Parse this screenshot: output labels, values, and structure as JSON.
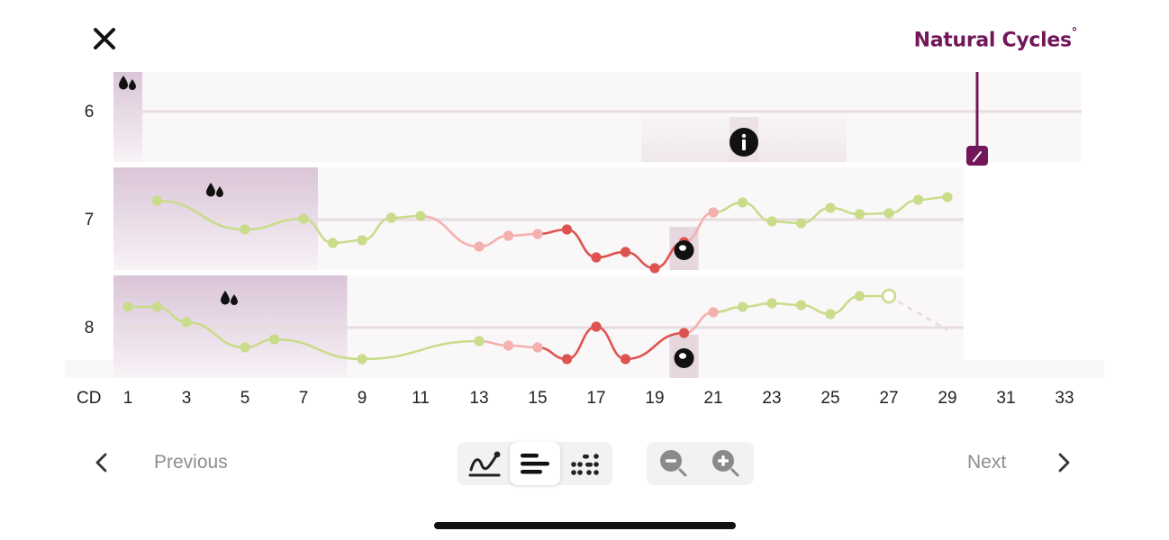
{
  "header": {
    "close_icon": "close-icon",
    "brand_name": "Natural Cycles",
    "brand_mark": "°",
    "brand_color": "#72185a"
  },
  "chart": {
    "row_labels": [
      "6",
      "7",
      "8"
    ],
    "period_icon": "blood-drops-icon",
    "info_icon": "info-icon",
    "ovulation_icon": "ovulation-icon",
    "today_icon": "thermometer-icon",
    "colors": {
      "green_day": "#c9dc8a",
      "red_day": "#de5350",
      "pink_day": "#f3b0ae",
      "period_band": "#dac5d8",
      "today_marker": "#72185a"
    }
  },
  "x_axis": {
    "label": "CD",
    "ticks": [
      "1",
      "3",
      "5",
      "7",
      "9",
      "11",
      "13",
      "15",
      "17",
      "19",
      "21",
      "23",
      "25",
      "27",
      "29",
      "31",
      "33"
    ]
  },
  "bottom_nav": {
    "previous_label": "Previous",
    "next_label": "Next",
    "view_modes": [
      "graph-view-icon",
      "cycle-list-view-icon",
      "dot-view-icon"
    ],
    "active_view": "cycle-list-view-icon",
    "zoom_out_icon": "zoom-out-icon",
    "zoom_in_icon": "zoom-in-icon"
  },
  "chart_data": {
    "type": "line",
    "xlabel": "CD",
    "xlim": [
      1,
      33
    ],
    "series": [
      {
        "name": "6",
        "points": [],
        "period_days": [
          1
        ],
        "today_cd": 30
      },
      {
        "name": "7",
        "points": [
          [
            2,
            0.75,
            "g"
          ],
          [
            5,
            0.43,
            "g"
          ],
          [
            7,
            0.55,
            "g"
          ],
          [
            8,
            0.28,
            "g"
          ],
          [
            9,
            0.31,
            "g"
          ],
          [
            10,
            0.56,
            "g"
          ],
          [
            11,
            0.58,
            "g"
          ],
          [
            13,
            0.24,
            "p"
          ],
          [
            14,
            0.36,
            "p"
          ],
          [
            15,
            0.38,
            "p"
          ],
          [
            16,
            0.43,
            "r"
          ],
          [
            17,
            0.12,
            "r"
          ],
          [
            18,
            0.18,
            "r"
          ],
          [
            19,
            0.0,
            "r"
          ],
          [
            20,
            0.29,
            "r"
          ],
          [
            21,
            0.62,
            "p"
          ],
          [
            22,
            0.73,
            "g"
          ],
          [
            23,
            0.52,
            "g"
          ],
          [
            24,
            0.5,
            "g"
          ],
          [
            25,
            0.67,
            "g"
          ],
          [
            26,
            0.6,
            "g"
          ],
          [
            27,
            0.61,
            "g"
          ],
          [
            28,
            0.76,
            "g"
          ],
          [
            29,
            0.79,
            "g"
          ]
        ],
        "period_days": [
          1,
          2,
          3,
          4,
          5,
          6,
          7
        ],
        "ovulation_cd": 20
      },
      {
        "name": "8",
        "points": [
          [
            1,
            0.58,
            "g"
          ],
          [
            2,
            0.58,
            "g"
          ],
          [
            3,
            0.41,
            "g"
          ],
          [
            5,
            0.13,
            "g"
          ],
          [
            6,
            0.22,
            "g"
          ],
          [
            9,
            0.0,
            "g"
          ],
          [
            13,
            0.2,
            "g"
          ],
          [
            14,
            0.15,
            "p"
          ],
          [
            15,
            0.13,
            "p"
          ],
          [
            16,
            0.0,
            "r"
          ],
          [
            17,
            0.36,
            "r"
          ],
          [
            18,
            0.0,
            "r"
          ],
          [
            20,
            0.29,
            "r"
          ],
          [
            21,
            0.52,
            "p"
          ],
          [
            22,
            0.58,
            "g"
          ],
          [
            23,
            0.62,
            "g"
          ],
          [
            24,
            0.6,
            "g"
          ],
          [
            25,
            0.5,
            "g"
          ],
          [
            26,
            0.7,
            "g"
          ],
          [
            27,
            0.7,
            "g"
          ]
        ],
        "projected": [
          [
            27,
            0.7
          ],
          [
            29,
            0.32
          ]
        ],
        "period_days": [
          1,
          2,
          3,
          4,
          5,
          6,
          7,
          8
        ],
        "ovulation_cd": 20
      }
    ]
  }
}
